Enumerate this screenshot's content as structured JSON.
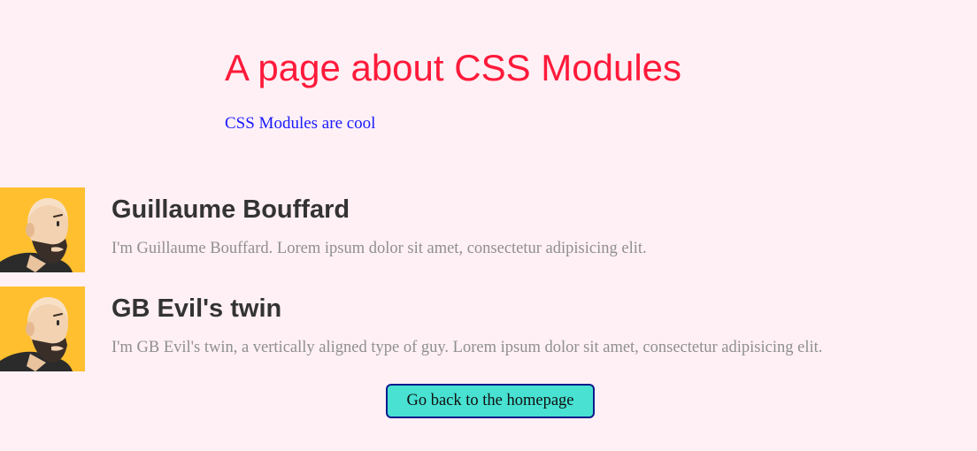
{
  "header": {
    "title": "A page about CSS Modules",
    "subtitle": "CSS Modules are cool"
  },
  "profiles": [
    {
      "name": "Guillaume Bouffard",
      "bio": "I'm Guillaume Bouffard. Lorem ipsum dolor sit amet, consectetur adipisicing elit.",
      "avatar_icon": "bald-bearded-man-avatar"
    },
    {
      "name": "GB Evil's twin",
      "bio": "I'm GB Evil's twin, a vertically aligned type of guy. Lorem ipsum dolor sit amet, consectetur adipisicing elit.",
      "avatar_icon": "bald-bearded-man-avatar"
    }
  ],
  "actions": {
    "home_button_label": "Go back to the homepage"
  },
  "colors": {
    "background": "#fff0f5",
    "title": "#ff1a3a",
    "subtitle": "#1a1aff",
    "name": "#333333",
    "bio": "#8f8f8f",
    "avatar_background": "#ffbf2f",
    "button_background": "#48e1d2",
    "button_border": "#0f1a8c"
  }
}
